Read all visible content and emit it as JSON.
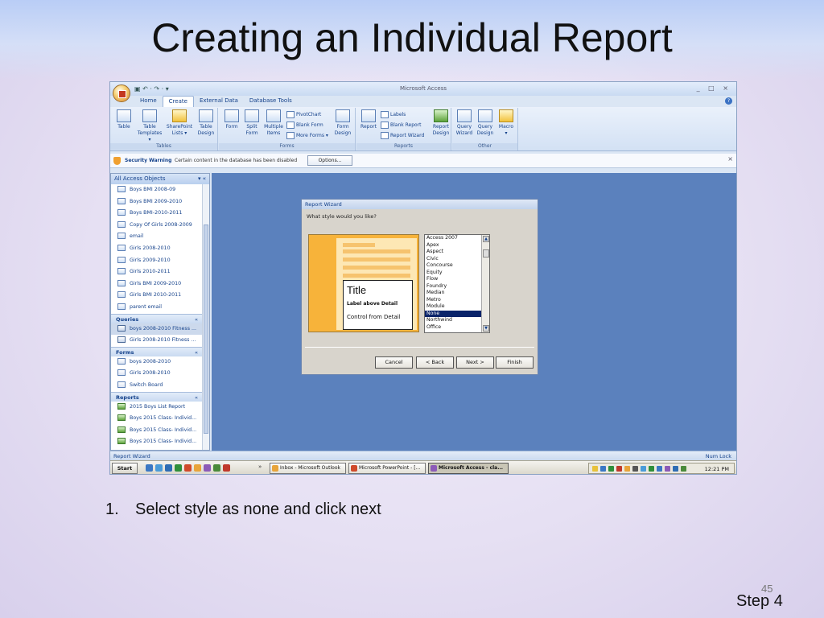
{
  "slide": {
    "title": "Creating an Individual Report",
    "instruction_number": "1.",
    "instruction": "Select style as none and click next",
    "slide_number": "45",
    "step": "Step 4"
  },
  "app": {
    "title": "Microsoft Access",
    "qat": "▣ ↶ · ↷ · ▾",
    "window_controls": "_ □ ×",
    "tabs": [
      "Home",
      "Create",
      "External Data",
      "Database Tools"
    ],
    "active_tab": "Create"
  },
  "ribbon": {
    "tables_group": "Tables",
    "forms_group": "Forms",
    "reports_group": "Reports",
    "other_group": "Other",
    "table": [
      "Table",
      ""
    ],
    "table_templates": [
      "Table",
      "Templates ▾"
    ],
    "sharepoint_lists": [
      "SharePoint",
      "Lists ▾"
    ],
    "table_design": [
      "Table",
      "Design"
    ],
    "form": [
      "Form",
      ""
    ],
    "split_form": [
      "Split",
      "Form"
    ],
    "multiple_items": [
      "Multiple",
      "Items"
    ],
    "pivotchart": "PivotChart",
    "blank_form": "Blank Form",
    "more_forms": "More Forms ▾",
    "form_design": [
      "Form",
      "Design"
    ],
    "report": [
      "Report",
      ""
    ],
    "labels": "Labels",
    "blank_report": "Blank Report",
    "report_wizard": "Report Wizard",
    "report_design": [
      "Report",
      "Design"
    ],
    "query_wizard": [
      "Query",
      "Wizard"
    ],
    "query_design": [
      "Query",
      "Design"
    ],
    "macro": [
      "Macro",
      "▾"
    ]
  },
  "security": {
    "title": "Security Warning",
    "message": "Certain content in the database has been disabled",
    "options_button": "Options...",
    "close": "×"
  },
  "nav": {
    "header": "All Access Objects",
    "header_ctrl": "▾  «",
    "section_ctrl": "«",
    "tables": [
      "Boys BMI 2008-09",
      "Boys BMI 2009-2010",
      "Boys BMI-2010-2011",
      "Copy Of Girls 2008-2009",
      "email",
      "Girls 2008-2010",
      "Girls 2009-2010",
      "Girls 2010-2011",
      "Girls BMI 2009-2010",
      "Girls BMI 2010-2011",
      "parent email"
    ],
    "queries_label": "Queries",
    "queries": [
      "boys 2008-2010 Fitness ...",
      "Girls 2008-2010 Fitness ..."
    ],
    "forms_label": "Forms",
    "forms": [
      "boys 2008-2010",
      "Girls 2008-2010",
      "Switch Board"
    ],
    "reports_label": "Reports",
    "reports": [
      "2015 Boys List Report",
      "Boys 2015 Class- Individ...",
      "Boys 2015 Class- Individ...",
      "Boys 2015 Class- Individ..."
    ]
  },
  "wizard": {
    "title": "Report Wizard",
    "question": "What style would you like?",
    "preview_title": "Title",
    "preview_label": "Label above Detail",
    "preview_control": "Control from Detail",
    "styles": [
      "Access 2007",
      "Apex",
      "Aspect",
      "Civic",
      "Concourse",
      "Equity",
      "Flow",
      "Foundry",
      "Median",
      "Metro",
      "Module",
      "None",
      "Northwind",
      "Office"
    ],
    "selected_style": "None",
    "cancel": "Cancel",
    "back": "< Back",
    "next": "Next >",
    "finish": "Finish"
  },
  "statusbar": {
    "left": "Report Wizard",
    "right": "Num Lock"
  },
  "taskbar": {
    "start": "Start",
    "chevron": "»",
    "tasks": [
      "Inbox - Microsoft Outlook",
      "Microsoft PowerPoint - [...",
      "Microsoft Access - cla..."
    ],
    "clock": "12:21 PM"
  }
}
